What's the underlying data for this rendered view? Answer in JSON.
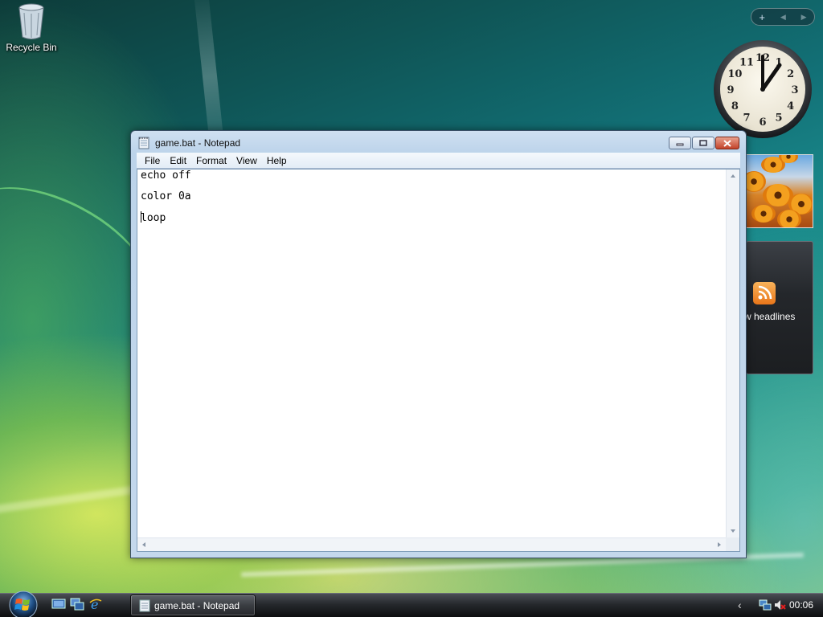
{
  "desktop": {
    "recycle_bin_label": "Recycle Bin"
  },
  "sidebar": {
    "add_glyph": "+",
    "prev_glyph": "◀",
    "next_glyph": "▶",
    "clock_numerals": [
      "12",
      "1",
      "2",
      "3",
      "4",
      "5",
      "6",
      "7",
      "8",
      "9",
      "10",
      "11"
    ],
    "clock_time": "12:05",
    "feeds_text": "w headlines"
  },
  "notepad": {
    "title": "game.bat - Notepad",
    "menu": [
      "File",
      "Edit",
      "Format",
      "View",
      "Help"
    ],
    "lines": [
      "echo off",
      "color 0a",
      "loop"
    ]
  },
  "taskbar": {
    "task_button_label": "game.bat - Notepad",
    "tray_chevron": "‹",
    "clock": "00:06"
  },
  "colors": {
    "title_text": "#111111",
    "close_button": "#c3432a",
    "taskbar": "#26292d"
  }
}
